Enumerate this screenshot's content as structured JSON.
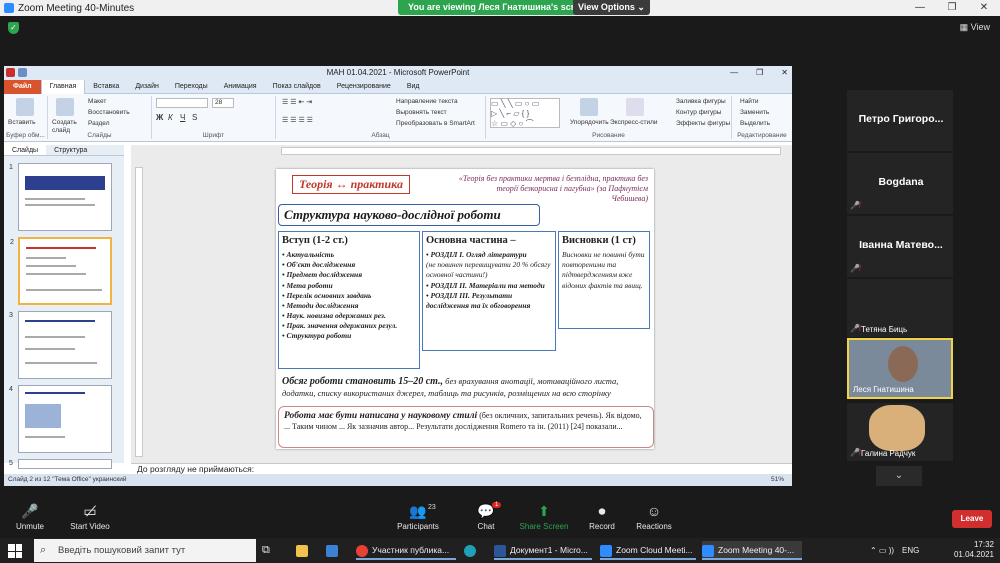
{
  "window": {
    "title": "Zoom Meeting 40-Minutes"
  },
  "banner": {
    "viewing": "You are viewing Леся Гнатишина's screen",
    "view_options": "View Options ⌄"
  },
  "top_right": {
    "view": "View"
  },
  "powerpoint": {
    "title": "МАН 01.04.2021  -  Microsoft PowerPoint",
    "tabs": [
      "Файл",
      "Главная",
      "Вставка",
      "Дизайн",
      "Переходы",
      "Анимация",
      "Показ слайдов",
      "Рецензирование",
      "Вид"
    ],
    "ribbon": {
      "paste": "Вставить",
      "create_slide": "Создать слайд",
      "layout": "Макет",
      "restore": "Восстановить",
      "section": "Раздел",
      "font_size": "28",
      "text_direction": "Направление текста",
      "align_text": "Выровнять текст",
      "smartart": "Преобразовать в SmartArt",
      "arrange": "Упорядочить",
      "express_styles": "Экспресс-стили",
      "shape_fill": "Заливка фигуры",
      "shape_outline": "Контур фигуры",
      "shape_effects": "Эффекты фигуры",
      "find": "Найти",
      "replace": "Заменить",
      "select": "Выделить",
      "groups": [
        "Буфер обм...",
        "Слайды",
        "Шрифт",
        "Абзац",
        "Рисование",
        "Редактирование"
      ]
    },
    "pane_tabs": [
      "Слайды",
      "Структура"
    ],
    "thumbs": [
      "1",
      "2",
      "3",
      "4",
      "5"
    ],
    "slide": {
      "teoriya": "Теорія ↔ практика",
      "quote": "«Теорія без практики мертва і безплідна, практика без теорії безкорисна і пагубна»",
      "quote_author": "(за Пафнутієм Чебишева)",
      "structure_title": "Структура науково-дослідної роботи",
      "box1_title": "Вступ (1-2 ст.)",
      "box1_items": [
        "Актуальність",
        "Об'єкт дослідження",
        "Предмет дослідження",
        "Мета роботи",
        "Перелік основних завдань",
        "Методи дослідження",
        "Наук. новизна одержаних рез.",
        "Прак. значення одержаних резул.",
        "Структура роботи"
      ],
      "box2_title": "Основна частина –",
      "box2_items": [
        "РОЗДІЛ І. Огляд літератури",
        "(не повинен перевищувати 20 % обсягу основної частини!)",
        "РОЗДІЛ ІІ. Матеріали та методи",
        "РОЗДІЛ ІІІ. Результати дослідження та їх обговорення"
      ],
      "box3_title": "Висновки (1 ст)",
      "box3_text": "Висновки не повинні бути повтореними та підтвердженням вже відомих фактів та явищ.",
      "volume_bold": "Обсяг роботи становить 15–20 ст.,",
      "volume_rest": "без врахування анотації, мотиваційного листа, додатки, списку використаних джерел, таблиць та рисунків, розміщених на всю сторінку",
      "style_bold": "Робота має бути написана у науковому стилі",
      "style_rest": "(без окличних, запитальних речень). Як відомо, ... Таким чином ... Як зазначив автор... Результати дослідження Romero та ін. (2011) [24] показали..."
    },
    "notes": "До розгляду не приймаються:",
    "status_left": "Слайд 2 из 12   \"Тема Office\"   украинский",
    "zoom": "51%"
  },
  "participants_tiles": [
    {
      "name": "Петро Григоро..."
    },
    {
      "name": "Bogdana"
    },
    {
      "name": "Іванна Матево..."
    },
    {
      "name": "Тетяна Биць"
    },
    {
      "name": "Леся Гнатишина"
    },
    {
      "name": "Галина Радчук"
    }
  ],
  "toolbar": {
    "unmute": "Unmute",
    "start_video": "Start Video",
    "participants": "Participants",
    "participants_count": "23",
    "chat": "Chat",
    "chat_badge": "1",
    "share": "Share Screen",
    "record": "Record",
    "reactions": "Reactions",
    "leave": "Leave"
  },
  "taskbar": {
    "search_placeholder": "Введіть пошуковий запит тут",
    "apps": [
      "Участник публика...",
      "Документ1 - Micro...",
      "Zoom Cloud Meeti...",
      "Zoom Meeting 40-..."
    ],
    "lang": "ENG",
    "time": "17:32",
    "date": "01.04.2021"
  }
}
